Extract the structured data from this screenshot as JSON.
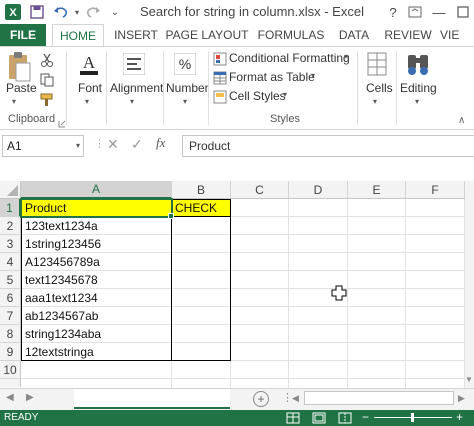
{
  "titlebar": {
    "title": "Search for string in column.xlsx - Excel"
  },
  "tabs": [
    "FILE",
    "HOME",
    "INSERT",
    "PAGE LAYOUT",
    "FORMULAS",
    "DATA",
    "REVIEW",
    "VIE"
  ],
  "ribbon": {
    "paste": "Paste",
    "clipboard": "Clipboard",
    "font": "Font",
    "alignment": "Alignment",
    "number": "Number",
    "conditional": "Conditional Formatting",
    "format_table": "Format as Table",
    "cell_styles": "Cell Styles",
    "styles": "Styles",
    "cells": "Cells",
    "editing": "Editing"
  },
  "formula_bar": {
    "name_box": "A1",
    "content": "Product"
  },
  "columns": [
    "A",
    "B",
    "C",
    "D",
    "E",
    "F"
  ],
  "rows": [
    "1",
    "2",
    "3",
    "4",
    "5",
    "6",
    "7",
    "8",
    "9",
    "10"
  ],
  "cells": {
    "a": [
      "Product",
      "123text1234a",
      "1string123456",
      "A123456789a",
      "text12345678",
      "aaa1text1234",
      "ab1234567ab",
      "string1234aba",
      "12textstringa"
    ],
    "b1": "CHECK"
  },
  "status": {
    "ready": "READY"
  },
  "colors": {
    "excel_green": "#217346",
    "header_fill": "#ffff00"
  }
}
